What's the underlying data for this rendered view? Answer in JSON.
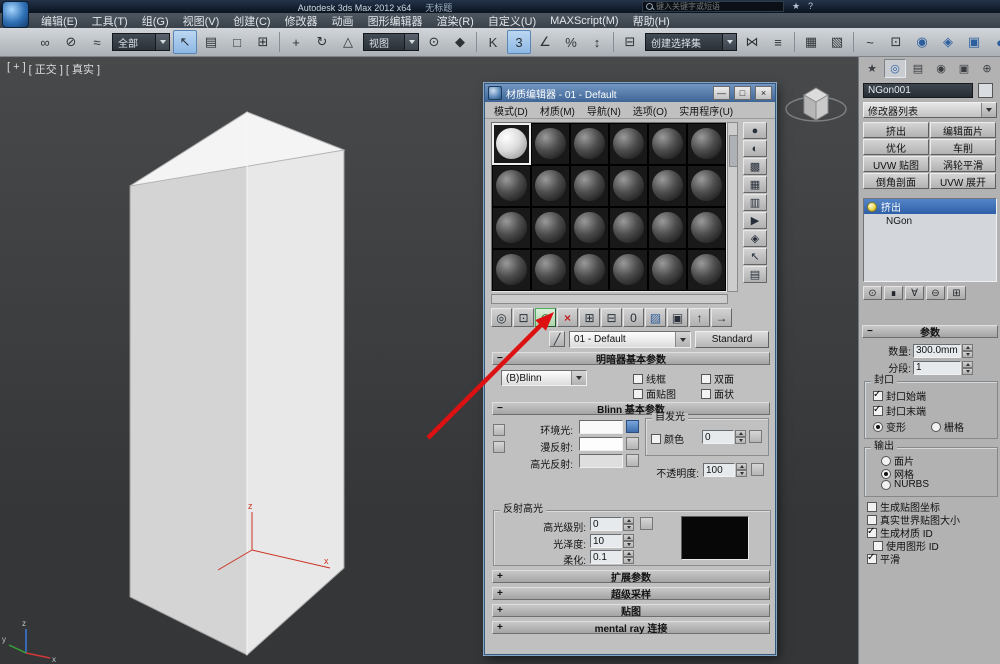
{
  "titlebar": {
    "product": "Autodesk 3ds Max 2012 x64",
    "document": "无标题",
    "search_placeholder": "键入关键字或短语",
    "infocenter": [
      {
        "name": "sign-in",
        "glyph": "★"
      },
      {
        "name": "help",
        "glyph": "?"
      }
    ]
  },
  "menubar": {
    "items": [
      "编辑(E)",
      "工具(T)",
      "组(G)",
      "视图(V)",
      "创建(C)",
      "修改器",
      "动画",
      "图形编辑器",
      "渲染(R)",
      "自定义(U)",
      "MAXScript(M)",
      "帮助(H)"
    ]
  },
  "toolbar": {
    "filter_value": "全部",
    "coord_value": "视图",
    "named_sets_value": "创建选择集",
    "icons": [
      {
        "name": "select-and-link",
        "glyph": "∞"
      },
      {
        "name": "unlink-selection",
        "glyph": "⊘"
      },
      {
        "name": "bind-to-space-warp",
        "glyph": "≈"
      },
      {
        "name": "select-object",
        "glyph": "↖"
      },
      {
        "name": "select-by-name",
        "glyph": "▤"
      },
      {
        "name": "rectangular-selection-region",
        "glyph": "□"
      },
      {
        "name": "window-crossing",
        "glyph": "⊞"
      },
      {
        "name": "select-and-move",
        "glyph": "+"
      },
      {
        "name": "select-and-rotate",
        "glyph": "↻"
      },
      {
        "name": "select-and-scale",
        "glyph": "△"
      },
      {
        "name": "use-pivot-point-center",
        "glyph": "⊙"
      },
      {
        "name": "select-and-manipulate",
        "glyph": "◆"
      },
      {
        "name": "keyboard-shortcut-override",
        "glyph": "K"
      },
      {
        "name": "snap-toggle-3d",
        "glyph": "3"
      },
      {
        "name": "angle-snap-toggle",
        "glyph": "∠"
      },
      {
        "name": "percent-snap-toggle",
        "glyph": "%"
      },
      {
        "name": "spinner-snap-toggle",
        "glyph": "↕"
      },
      {
        "name": "edit-named-selection-sets",
        "glyph": "⊟"
      },
      {
        "name": "mirror",
        "glyph": "⋈"
      },
      {
        "name": "align",
        "glyph": "≡"
      },
      {
        "name": "layer-manager",
        "glyph": "▦"
      },
      {
        "name": "graphite-modeling-ribbon",
        "glyph": "▧"
      },
      {
        "name": "curve-editor",
        "glyph": "~"
      },
      {
        "name": "schematic-view",
        "glyph": "⊡"
      },
      {
        "name": "material-editor",
        "glyph": "◉"
      },
      {
        "name": "render-setup",
        "glyph": "◈"
      },
      {
        "name": "rendered-frame-window",
        "glyph": "▣"
      },
      {
        "name": "render-production",
        "glyph": "●"
      }
    ]
  },
  "viewport": {
    "labels": {
      "plus": "[ + ]",
      "view": "[ 正交 ]",
      "shading": "[ 真实 ]"
    },
    "pivot_axis": {
      "x": "x",
      "z": "z"
    },
    "corner_axis": {
      "x": "x",
      "y": "y",
      "z": "z"
    }
  },
  "material_editor": {
    "title": "材质编辑器 - 01 - Default",
    "window_buttons": {
      "minimize": "—",
      "maximize": "□",
      "close": "×"
    },
    "menu": [
      "模式(D)",
      "材质(M)",
      "导航(N)",
      "选项(O)",
      "实用程序(U)"
    ],
    "side_icons": [
      {
        "name": "sample-type",
        "glyph": "●"
      },
      {
        "name": "backlight",
        "glyph": "◐"
      },
      {
        "name": "background",
        "glyph": "▩"
      },
      {
        "name": "sample-uv-tiling",
        "glyph": "▦"
      },
      {
        "name": "video-color-check",
        "glyph": "▥"
      },
      {
        "name": "make-preview",
        "glyph": "▶"
      },
      {
        "name": "material-editor-options",
        "glyph": "◈"
      },
      {
        "name": "select-by-material",
        "glyph": "↖"
      },
      {
        "name": "material-map-navigator",
        "glyph": "▤"
      }
    ],
    "toolbar_icons": [
      {
        "name": "get-material",
        "glyph": "◎"
      },
      {
        "name": "put-material-to-scene",
        "glyph": "⊡"
      },
      {
        "name": "assign-material-to-selection",
        "glyph": "⊙"
      },
      {
        "name": "reset-map-mtl",
        "glyph": "×"
      },
      {
        "name": "make-material-copy",
        "glyph": "⊞"
      },
      {
        "name": "put-to-library",
        "glyph": "⊟"
      },
      {
        "name": "material-id-channel",
        "glyph": "0"
      },
      {
        "name": "show-shaded-material-in-viewport",
        "glyph": "▨"
      },
      {
        "name": "show-end-result",
        "glyph": "▣"
      },
      {
        "name": "go-to-parent",
        "glyph": "↑"
      },
      {
        "name": "go-forward-to-sibling",
        "glyph": "→"
      }
    ],
    "pick_icon_glyph": "╱",
    "material_name": "01 - Default",
    "type_button": "Standard",
    "shader_basic": {
      "title": "明暗器基本参数",
      "shader": "(B)Blinn",
      "wire": "线框",
      "two_sided": "双面",
      "face_map": "面贴图",
      "faceted": "面状"
    },
    "blinn_basic": {
      "title": "Blinn 基本参数",
      "ambient": "环境光:",
      "diffuse": "漫反射:",
      "specular": "高光反射:",
      "self_illum_title": "自发光",
      "color_label": "颜色",
      "self_illum_value": "0",
      "opacity_label": "不透明度:",
      "opacity_value": "100"
    },
    "specular_highlights": {
      "title": "反射高光",
      "level_label": "高光级别:",
      "level_value": "0",
      "gloss_label": "光泽度:",
      "gloss_value": "10",
      "soften_label": "柔化:",
      "soften_value": "0.1"
    },
    "rollouts": [
      "扩展参数",
      "超级采样",
      "贴图",
      "mental ray 连接"
    ]
  },
  "command_panel": {
    "tabs": [
      {
        "name": "create",
        "glyph": "★"
      },
      {
        "name": "modify",
        "glyph": "◎"
      },
      {
        "name": "hierarchy",
        "glyph": "▤"
      },
      {
        "name": "motion",
        "glyph": "◉"
      },
      {
        "name": "display",
        "glyph": "▣"
      },
      {
        "name": "utilities",
        "glyph": "⊕"
      }
    ],
    "object_name": "NGon001",
    "modifier_list_label": "修改器列表",
    "modifier_buttons": [
      "挤出",
      "编辑面片",
      "优化",
      "车削",
      "UVW 贴图",
      "涡轮平滑",
      "倒角剖面",
      "UVW 展开"
    ],
    "stack": {
      "selected": "挤出",
      "base": "NGon"
    },
    "stack_icons": [
      {
        "name": "pin-stack",
        "glyph": "⊙"
      },
      {
        "name": "show-end-result",
        "glyph": "∎"
      },
      {
        "name": "make-unique",
        "glyph": "∀"
      },
      {
        "name": "remove-modifier",
        "glyph": "⊖"
      },
      {
        "name": "configure-modifier-sets",
        "glyph": "⊞"
      }
    ],
    "params": {
      "title": "参数",
      "amount_label": "数量:",
      "amount_value": "300.0mm",
      "segments_label": "分段:",
      "segments_value": "1",
      "cap_title": "封口",
      "cap_start": "封口始端",
      "cap_end": "封口末端",
      "morph": "变形",
      "grid": "栅格",
      "output_title": "输出",
      "patch": "面片",
      "mesh": "网格",
      "nurbs": "NURBS",
      "gen_mapping": "生成贴图坐标",
      "real_world": "真实世界贴图大小",
      "gen_matid": "生成材质 ID",
      "use_shape_id": "使用图形 ID",
      "smooth": "平滑"
    }
  }
}
